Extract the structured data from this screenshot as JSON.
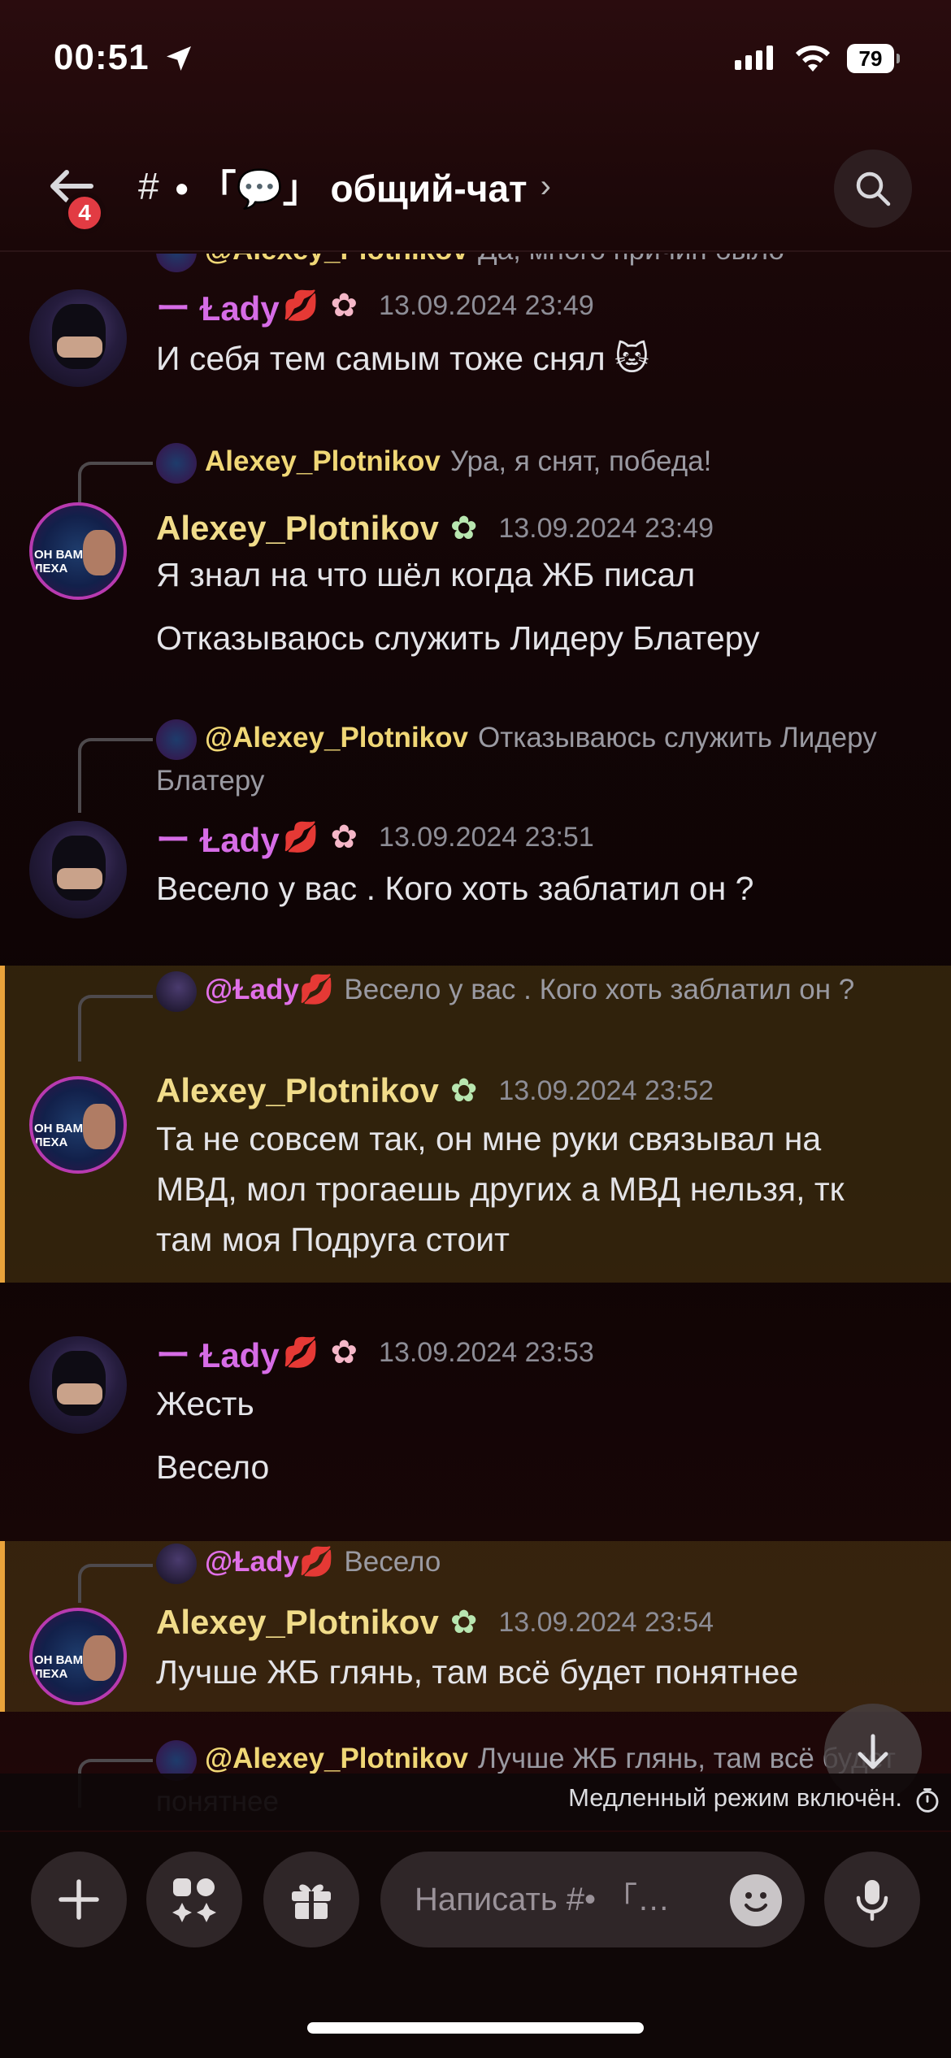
{
  "status_bar": {
    "time": "00:51",
    "battery": "79"
  },
  "header": {
    "unread_count": "4",
    "channel_hash": "#",
    "channel_name": "• 「💬」 общий-чат",
    "chevron": "›"
  },
  "cut_reply_top": {
    "name": "@Alexey_Plotnikov",
    "text": "Да, много причин было"
  },
  "messages": [
    {
      "author": "ー Ɫady",
      "badge": "💋",
      "flower": "✿",
      "timestamp": "13.09.2024 23:49",
      "lines": [
        "И себя тем самым тоже снял 🐱"
      ]
    },
    {
      "reply_name": "Alexey_Plotnikov",
      "reply_text": "Ура, я снят, победа!",
      "author": "Alexey_Plotnikov",
      "flower": "✿",
      "timestamp": "13.09.2024 23:49",
      "lines": [
        "Я знал на что шёл когда ЖБ писал",
        "Отказываюсь служить Лидеру Блатеру"
      ]
    },
    {
      "reply_name": "@Alexey_Plotnikov",
      "reply_text": "Отказываюсь служить Лидеру Блатеру",
      "author": "ー Ɫady",
      "badge": "💋",
      "flower": "✿",
      "timestamp": "13.09.2024 23:51",
      "lines": [
        "Весело у вас . Кого хоть заблатил он ?"
      ]
    },
    {
      "reply_name": "@Ɫady💋",
      "reply_text": "Весело у вас . Кого хоть заблатил он ?",
      "author": "Alexey_Plotnikov",
      "flower": "✿",
      "timestamp": "13.09.2024 23:52",
      "lines": [
        "Та не совсем так, он мне руки связывал на МВД, мол трогаешь других а МВД нельзя, тк там моя Подруга стоит"
      ]
    },
    {
      "author": "ー Ɫady",
      "badge": "💋",
      "flower": "✿",
      "timestamp": "13.09.2024 23:53",
      "lines": [
        "Жесть",
        "Весело"
      ]
    },
    {
      "reply_name": "@Ɫady💋",
      "reply_text": "Весело",
      "author": "Alexey_Plotnikov",
      "flower": "✿",
      "timestamp": "13.09.2024 23:54",
      "lines": [
        "Лучше ЖБ глянь, там всё будет понятнее"
      ]
    }
  ],
  "cut_reply_bottom": {
    "name": "@Alexey_Plotnikov",
    "text": "Лучше ЖБ глянь, там всё будет понятнее"
  },
  "slowmode": "Медленный режим включён.",
  "composer": {
    "placeholder": "Написать #• 「…"
  },
  "avatar_text": "ОН ВАМ НЕ ЛЕХА",
  "colors": {
    "lady_name": "#d66ce6",
    "alexey_name": "#f1dc8a",
    "mention_bar": "#e9a33b",
    "badge_red": "#e23b43"
  }
}
